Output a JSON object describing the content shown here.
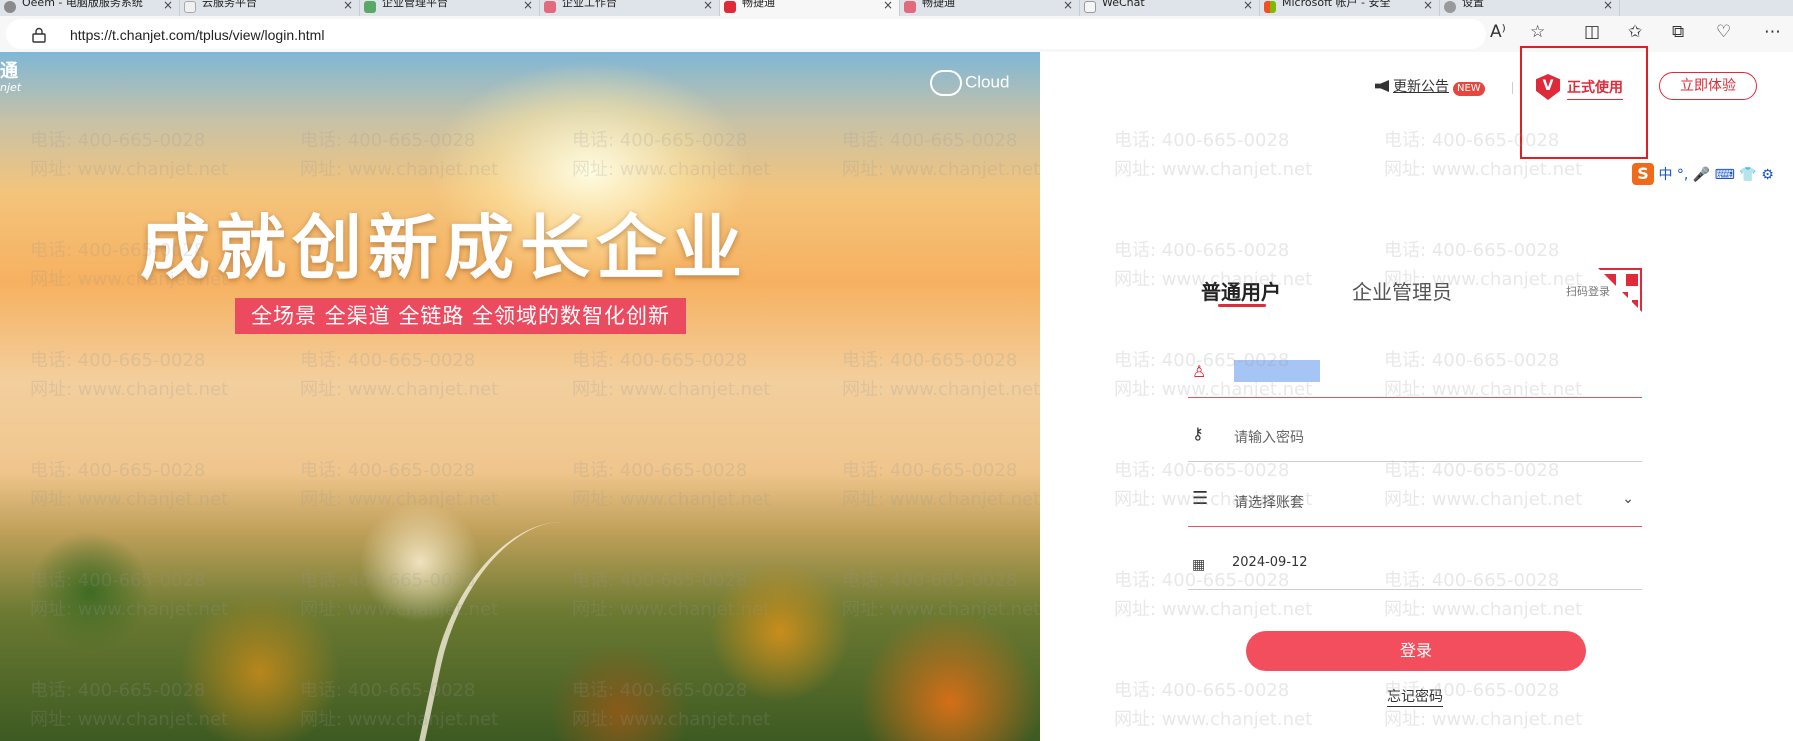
{
  "browser": {
    "tabs": [
      {
        "title": "Oeem - 电脑版服务系统"
      },
      {
        "title": "云服务平台"
      },
      {
        "title": "企业管理平台"
      },
      {
        "title": "企业工作台"
      },
      {
        "title": "畅捷通"
      },
      {
        "title": "畅捷通"
      },
      {
        "title": "WeChat"
      },
      {
        "title": "Microsoft 帐户 - 安全"
      },
      {
        "title": "设置"
      }
    ],
    "url": "https://t.chanjet.com/tplus/view/login.html"
  },
  "hero": {
    "brand_cn": "通",
    "brand_en": "njet",
    "cloud_logo": "Cloud",
    "title": "成就创新成长企业",
    "subtitle": "全场景 全渠道 全链路 全领域的数智化创新"
  },
  "watermark": {
    "phone": "电话: 400-665-0028",
    "site": "网址: www.chanjet.net"
  },
  "header": {
    "notice_label": "更新公告",
    "new_badge": "NEW",
    "formal_use_label": "正式使用",
    "formal_use_badge": "V",
    "try_now_label": "立即体验"
  },
  "ime_toolbar": {
    "logo": "S",
    "items": "中 °, 🎤 ⌨ 👕 ⚙"
  },
  "login": {
    "tab_user": "普通用户",
    "tab_admin": "企业管理员",
    "qr_label": "扫码登录",
    "password_placeholder": "请输入密码",
    "account_placeholder": "请选择账套",
    "date_value": "2024-09-12",
    "login_button": "登录",
    "forgot_password": "忘记密码"
  },
  "colors": {
    "accent": "#e02a3a",
    "button": "#f24e5d"
  }
}
